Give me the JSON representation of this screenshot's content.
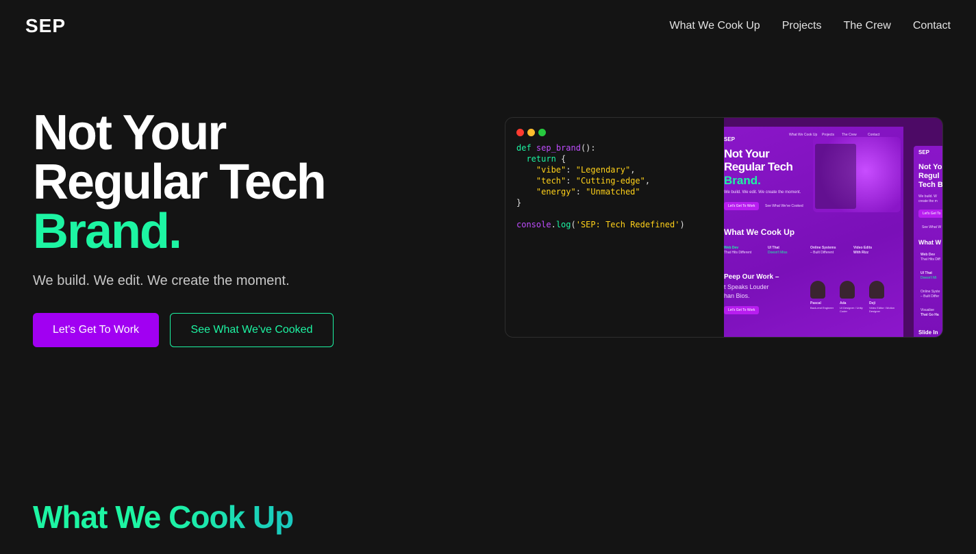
{
  "brand": {
    "logo": "SEP"
  },
  "nav": {
    "items": [
      {
        "label": "What We Cook Up"
      },
      {
        "label": "Projects"
      },
      {
        "label": "The Crew"
      },
      {
        "label": "Contact"
      }
    ]
  },
  "hero": {
    "title_line1": "Not Your",
    "title_line2": "Regular Tech",
    "title_accent": "Brand.",
    "subtitle": "We build. We edit. We create the moment.",
    "primary_button": "Let's Get To Work",
    "secondary_button": "See What We've Cooked"
  },
  "code_window": {
    "dots": [
      "#ff3b30",
      "#ffbd2e",
      "#27c93f"
    ],
    "lines": {
      "def_kw": "def",
      "fn_name": "sep_brand",
      "fn_parens": "():",
      "return_kw": "return",
      "brace_open": "{",
      "k1": "\"vibe\"",
      "v1": "\"Legendary\"",
      "k2": "\"tech\"",
      "v2": "\"Cutting-edge\"",
      "k3": "\"energy\"",
      "v3": "\"Unmatched\"",
      "brace_close": "}",
      "console": "console",
      "log": "log",
      "log_arg": "'SEP: Tech Redefined'"
    }
  },
  "preview": {
    "logo": "SEP",
    "nav_items": [
      "What We Cook Up",
      "Projects",
      "The Crew",
      "Contact"
    ],
    "title": "Not Your Regular Tech",
    "accent": "Brand.",
    "subtitle": "We build. We edit. We create the moment.",
    "btn1": "Let's Get To Work",
    "btn2": "See What We've Cooked",
    "section1": "What We Cook Up",
    "services": [
      {
        "l1": "Web Dev",
        "l2": "That Hits Different"
      },
      {
        "l1": "UI That",
        "l2": "Doesn't Miss"
      },
      {
        "l1": "Online Systems",
        "l2": "– Built Different"
      },
      {
        "l1": "Video Edits",
        "l2": "With Rizz"
      }
    ],
    "section2_l1": "Peep Our Work –",
    "section2_l2": "t Speaks Louder",
    "section2_l3": "han Bios.",
    "btn3": "Let's Get To Work",
    "crew": [
      {
        "name": "Pascal",
        "role": "Back-end Engineer"
      },
      {
        "name": "Ada",
        "role": "UI Designer / Unity Coder"
      },
      {
        "name": "Deji",
        "role": "Video Editor / Motion Designer"
      }
    ],
    "side": {
      "logo": "SEP",
      "title_l1": "Not Yo",
      "title_l2": "Regul",
      "title_l3": "Tech B",
      "sub_l1": "We build. W",
      "sub_l2": "create the m",
      "btn": "Let's Get To",
      "btn2": "See What W",
      "section": "What W",
      "items": [
        "Web Dev",
        "That Hits Diff",
        "UI That",
        "Doesn't Mi",
        "Online Syste",
        "– Built Differ",
        "Visualise",
        "That Go Ha",
        "Slide In"
      ]
    }
  },
  "section": {
    "title": "What We Cook Up"
  },
  "colors": {
    "background": "#141414",
    "accent_green": "#1df5a3",
    "accent_purple": "#a100f2"
  }
}
